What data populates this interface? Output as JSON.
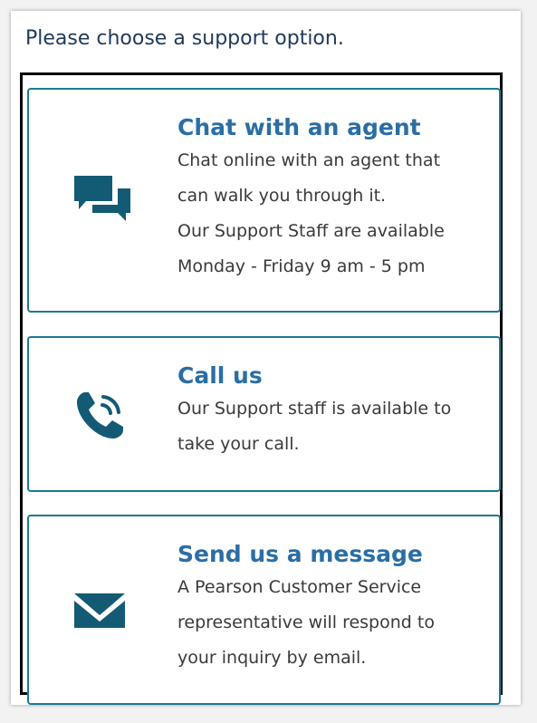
{
  "heading": "Please choose a support option.",
  "colors": {
    "accent": "#1a7b92",
    "title": "#2a6ea6",
    "icon": "#135b74",
    "heading": "#1f3a5a"
  },
  "options": [
    {
      "title": "Chat with an agent",
      "description": [
        "Chat online with an agent that",
        "can walk you through it.",
        "Our Support Staff are available",
        "Monday - Friday 9 am - 5 pm"
      ],
      "icon": "chat-bubbles-icon"
    },
    {
      "title": "Call us",
      "description": [
        "Our Support staff is available to",
        "take your call."
      ],
      "icon": "phone-ringing-icon"
    },
    {
      "title": "Send us a message",
      "description": [
        "A Pearson Customer Service",
        "representative will respond to",
        "your inquiry by email."
      ],
      "icon": "envelope-icon"
    }
  ]
}
